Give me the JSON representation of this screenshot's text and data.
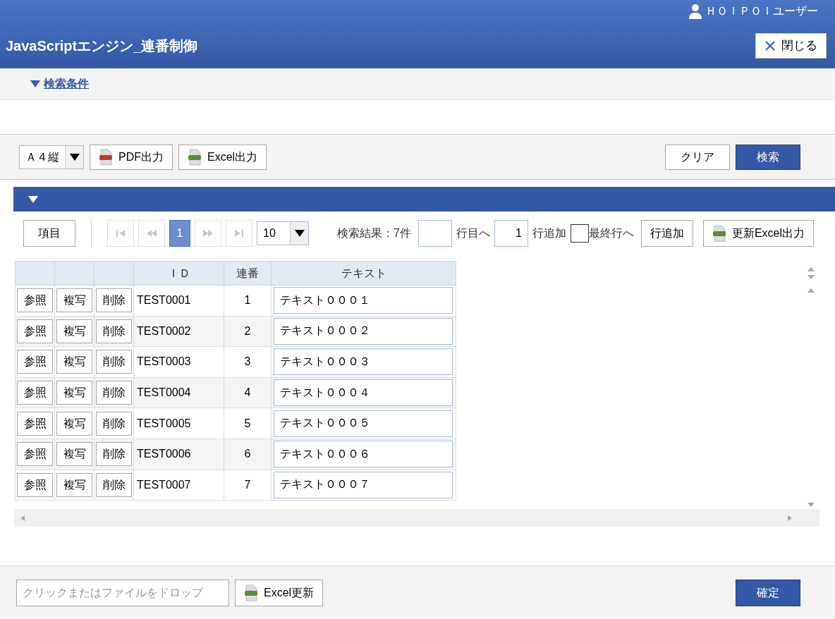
{
  "header": {
    "user": "ＨＯＩＰＯＩユーザー",
    "title": "JavaScriptエンジン_連番制御",
    "close_button": "閉じる"
  },
  "search_conditions": {
    "label": "検索条件",
    "expanded": true
  },
  "toolbar": {
    "paper_select": "Ａ４縦",
    "pdf_button": "PDF出力",
    "excel_button": "Excel出力",
    "clear_button": "クリア",
    "search_button": "検索"
  },
  "result_panel": {
    "expanded": true
  },
  "grid_toolbar": {
    "columns_button": "項目",
    "pages": [
      {
        "label": "1",
        "selected": true
      }
    ],
    "page_size": "10",
    "result_count": "検索結果：7件",
    "goto_label": "行目へ",
    "add_count": "1",
    "add_label": "行追加",
    "last_row": {
      "label": "最終行へ",
      "checked": false
    },
    "add_button": "行追加",
    "update_excel_button": "更新Excel出力"
  },
  "table": {
    "columns": [
      "",
      "",
      "",
      "ＩＤ",
      "連番",
      "テキスト"
    ],
    "rows": [
      {
        "ref": "参照",
        "copy": "複写",
        "delete": "削除",
        "id": "TEST0001",
        "seq": "1",
        "text": "テキスト０００１"
      },
      {
        "ref": "参照",
        "copy": "複写",
        "delete": "削除",
        "id": "TEST0002",
        "seq": "2",
        "text": "テキスト０００２"
      },
      {
        "ref": "参照",
        "copy": "複写",
        "delete": "削除",
        "id": "TEST0003",
        "seq": "3",
        "text": "テキスト０００３"
      },
      {
        "ref": "参照",
        "copy": "複写",
        "delete": "削除",
        "id": "TEST0004",
        "seq": "4",
        "text": "テキスト０００４"
      },
      {
        "ref": "参照",
        "copy": "複写",
        "delete": "削除",
        "id": "TEST0005",
        "seq": "5",
        "text": "テキスト０００５"
      },
      {
        "ref": "参照",
        "copy": "複写",
        "delete": "削除",
        "id": "TEST0006",
        "seq": "6",
        "text": "テキスト０００６"
      },
      {
        "ref": "参照",
        "copy": "複写",
        "delete": "削除",
        "id": "TEST0007",
        "seq": "7",
        "text": "テキスト０００７"
      }
    ]
  },
  "footer": {
    "file_drop": {
      "placeholder": "クリックまたはファイルをドロップ"
    },
    "excel_update_button": "Excel更新",
    "confirm_button": "確定"
  }
}
